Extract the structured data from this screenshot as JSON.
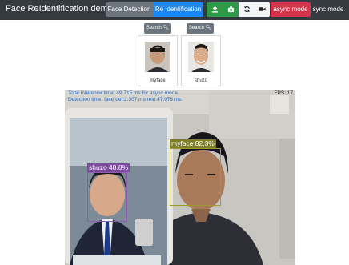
{
  "header": {
    "title": "Face ReIdentification demo",
    "mode_buttons": [
      "Face Detection",
      "Re Identification"
    ],
    "icons": [
      "upload-icon",
      "camera-icon",
      "refresh-icon",
      "video-icon"
    ],
    "async_label": "async mode",
    "sync_label": "sync mode"
  },
  "gallery": [
    {
      "search_label": "Search",
      "name": "myface"
    },
    {
      "search_label": "Search",
      "name": "shuzo"
    }
  ],
  "video": {
    "stat_line_1": "Total Inference time: 49.715 ms for async mode",
    "stat_line_2": "Detection time: face det:2.307 ms reid:47.078 ms",
    "fps": "FPS: 17",
    "detections": [
      {
        "label": "myface 82.3%"
      },
      {
        "label": "shuzo 48.8%"
      }
    ]
  }
}
